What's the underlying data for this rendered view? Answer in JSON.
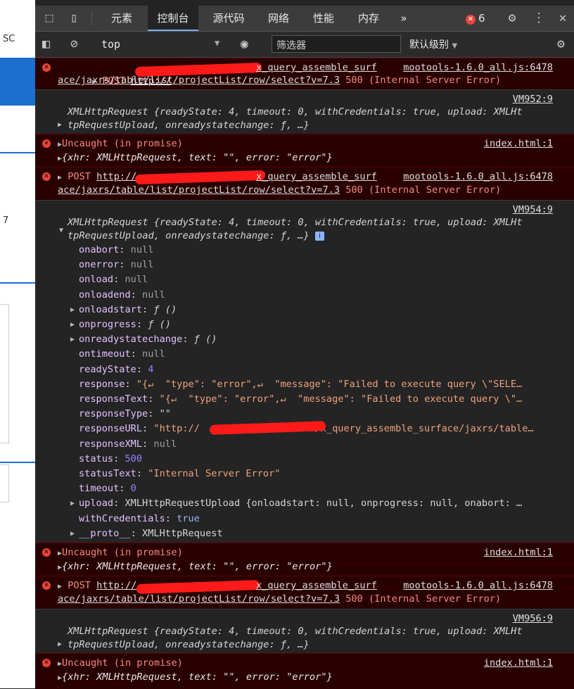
{
  "left_pane": {
    "text_1": "SC",
    "text_2": "7"
  },
  "tabs": [
    "元素",
    "控制台",
    "源代码",
    "网络",
    "性能",
    "内存"
  ],
  "active_tab": "控制台",
  "more_tabs": "»",
  "error_count": "6",
  "context": "top",
  "filter_placeholder": "筛选器",
  "levels": "默认级别",
  "log": {
    "post1": {
      "method": "POST",
      "url_prefix": "http://",
      "url_tail": "x_query_assemble_surf",
      "url_line2": "ace/jaxrs/table/list/projectList/row/select?v=7.3",
      "status": "500 (Internal Server Error)",
      "source": "mootools-1.6.0_all.js:6478"
    },
    "xhr1": {
      "source": "VM952:9",
      "line1": "XMLHttpRequest {readyState: 4, timeout: 0, withCredentials: true, upload: XMLHt",
      "line2": "tpRequestUpload, onreadystatechange: ƒ, …}"
    },
    "uncaught1": {
      "label": "Uncaught (in promise)",
      "source": "index.html:1",
      "obj": "{xhr: XMLHttpRequest, text: \"\", error: \"error\"}"
    },
    "post2": {
      "method": "POST",
      "url_prefix": "http://",
      "url_tail": "x_query_assemble_surf",
      "url_line2": "ace/jaxrs/table/list/projectList/row/select?v=7.3",
      "status": "500 (Internal Server Error)",
      "source": "mootools-1.6.0_all.js:6478"
    },
    "xhr2": {
      "source": "VM954:9",
      "line1": "XMLHttpRequest {readyState: 4, timeout: 0, withCredentials: true, upload: XMLHt",
      "line2": "tpRequestUpload, onreadystatechange: ƒ, …}",
      "info_badge": "i",
      "props": [
        {
          "key": "onabort",
          "val": "null",
          "type": "nul",
          "expandable": false
        },
        {
          "key": "onerror",
          "val": "null",
          "type": "nul",
          "expandable": false
        },
        {
          "key": "onload",
          "val": "null",
          "type": "nul",
          "expandable": false
        },
        {
          "key": "onloadend",
          "val": "null",
          "type": "nul",
          "expandable": false
        },
        {
          "key": "onloadstart",
          "val": "ƒ ()",
          "type": "fn",
          "expandable": true
        },
        {
          "key": "onprogress",
          "val": "ƒ ()",
          "type": "fn",
          "expandable": true
        },
        {
          "key": "onreadystatechange",
          "val": "ƒ ()",
          "type": "fn",
          "expandable": true
        },
        {
          "key": "ontimeout",
          "val": "null",
          "type": "nul",
          "expandable": false
        },
        {
          "key": "readyState",
          "val": "4",
          "type": "num",
          "expandable": false
        },
        {
          "key": "response",
          "val": "\"{↵  \"type\": \"error\",↵  \"message\": \"Failed to execute query \\\"SELE…",
          "type": "str",
          "expandable": false
        },
        {
          "key": "responseText",
          "val": "\"{↵  \"type\": \"error\",↵  \"message\": \"Failed to execute query \\\"…",
          "type": "str",
          "expandable": false
        },
        {
          "key": "responseType",
          "val": "\"\"",
          "type": "plain",
          "expandable": false
        },
        {
          "key": "responseURL",
          "val": "\"http://                    /x_query_assemble_surface/jaxrs/table…",
          "type": "str",
          "expandable": false
        },
        {
          "key": "responseXML",
          "val": "null",
          "type": "nul",
          "expandable": false
        },
        {
          "key": "status",
          "val": "500",
          "type": "num",
          "expandable": false
        },
        {
          "key": "statusText",
          "val": "\"Internal Server Error\"",
          "type": "str",
          "expandable": false
        },
        {
          "key": "timeout",
          "val": "0",
          "type": "num",
          "expandable": false
        },
        {
          "key": "upload",
          "val": "XMLHttpRequestUpload {onloadstart: null, onprogress: null, onabort: …",
          "type": "plain",
          "expandable": true
        },
        {
          "key": "withCredentials",
          "val": "true",
          "type": "kw",
          "expandable": false
        },
        {
          "key": "__proto__",
          "val": "XMLHttpRequest",
          "type": "plain",
          "expandable": true
        }
      ]
    },
    "uncaught2": {
      "label": "Uncaught (in promise)",
      "source": "index.html:1",
      "obj": "{xhr: XMLHttpRequest, text: \"\", error: \"error\"}"
    },
    "post3": {
      "method": "POST",
      "url_prefix": "http://",
      "url_tail": "x_query_assemble_surf",
      "url_line2": "ace/jaxrs/table/list/projectList/row/select?v=7.3",
      "status": "500 (Internal Server Error)",
      "source": "mootools-1.6.0_all.js:6478"
    },
    "xhr3": {
      "source": "VM956:9",
      "line1": "XMLHttpRequest {readyState: 4, timeout: 0, withCredentials: true, upload: XMLHt",
      "line2": "tpRequestUpload, onreadystatechange: ƒ, …}"
    },
    "uncaught3": {
      "label": "Uncaught (in promise)",
      "source": "index.html:1",
      "obj": "{xhr: XMLHttpRequest, text: \"\", error: \"error\"}"
    }
  },
  "colors": {
    "error_bg": "#290000",
    "error_text": "#f28b82",
    "accent": "#7cacf8",
    "redaction": "#ff1a1a"
  }
}
